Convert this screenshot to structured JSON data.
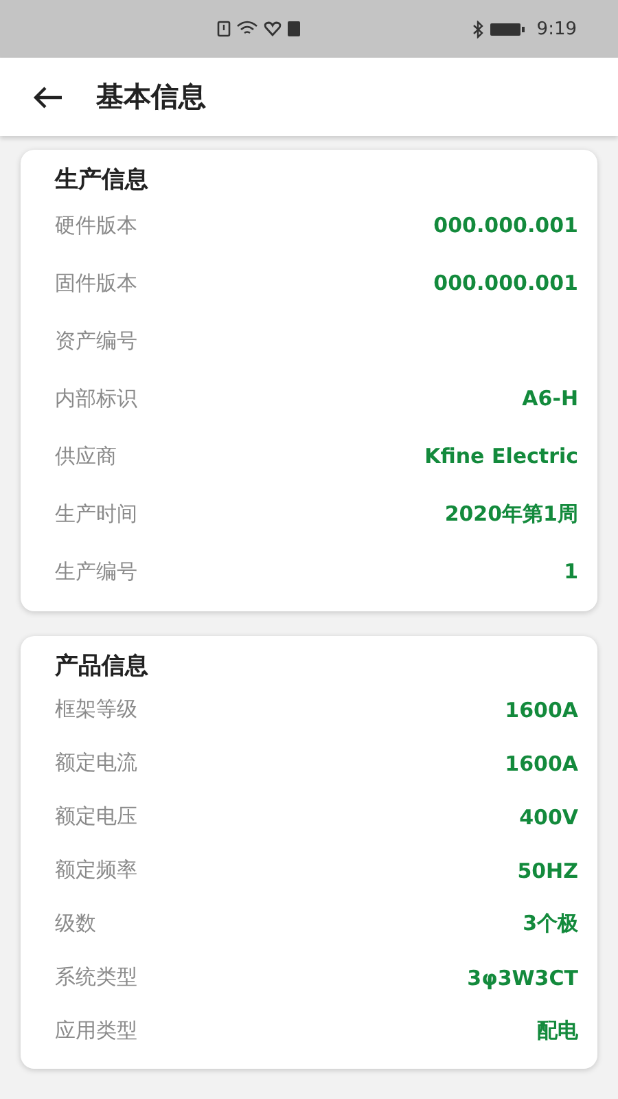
{
  "status_bar": {
    "time": "9:19"
  },
  "app_bar": {
    "title": "基本信息"
  },
  "sections": [
    {
      "title": "生产信息",
      "rows": [
        {
          "label": "硬件版本",
          "value": "000.000.001"
        },
        {
          "label": "固件版本",
          "value": "000.000.001"
        },
        {
          "label": "资产编号"
        },
        {
          "label": "内部标识",
          "value": "A6-H"
        },
        {
          "label": "供应商",
          "value": "Kfine Electric"
        },
        {
          "label": "生产时间",
          "value": "2020年第1周"
        },
        {
          "label": "生产编号",
          "value": "1"
        }
      ]
    },
    {
      "title": "产品信息",
      "rows": [
        {
          "label": "框架等级",
          "value": "1600A"
        },
        {
          "label": "额定电流",
          "value": "1600A"
        },
        {
          "label": "额定电压",
          "value": "400V"
        },
        {
          "label": "额定频率",
          "value": "50HZ"
        },
        {
          "label": "级数",
          "value": "3个极"
        },
        {
          "label": "系统类型",
          "value": "3φ3W3CT"
        },
        {
          "label": "应用类型",
          "value": "配电"
        }
      ]
    }
  ]
}
